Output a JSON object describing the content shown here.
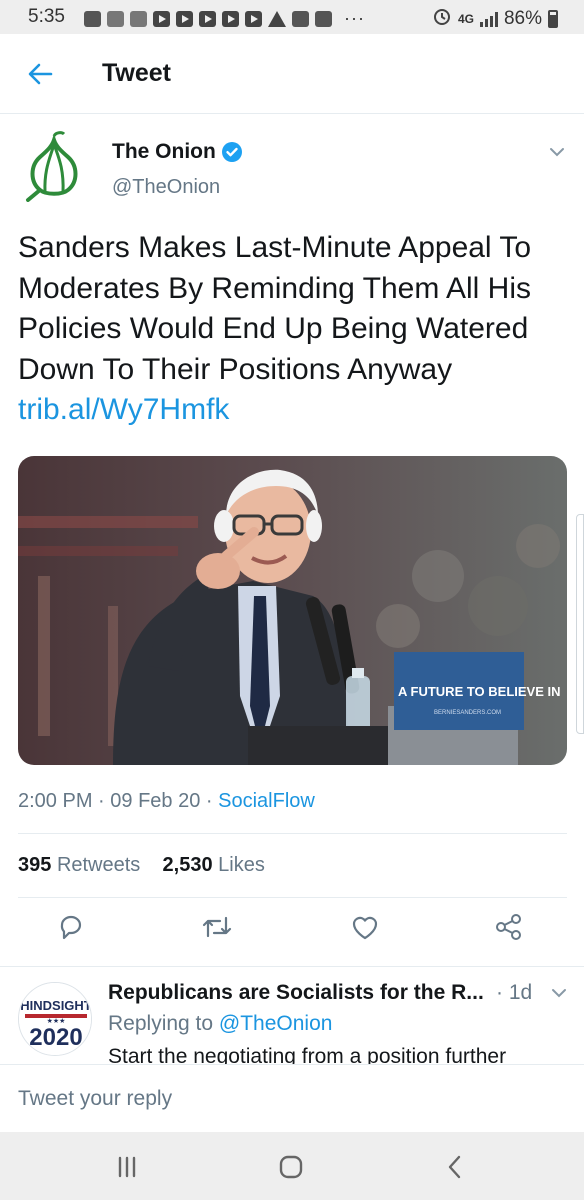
{
  "status_bar": {
    "time": "5:35",
    "network": "4G",
    "battery": "86%"
  },
  "header": {
    "title": "Tweet"
  },
  "tweet": {
    "author_name": "The Onion",
    "author_handle": "@TheOnion",
    "text": "Sanders Makes Last-Minute Appeal To Moderates By Reminding Them All His Policies Would End Up Being Watered Down To Their Positions Anyway",
    "link": "trib.al/Wy7Hmfk",
    "media": {
      "sign_text": "A FUTURE TO BELIEVE IN",
      "sign_subtext": "BERNIESANDERS.COM"
    },
    "time": "2:00 PM",
    "date": "09 Feb 20",
    "source": "SocialFlow",
    "retweets_count": "395",
    "retweets_label": "Retweets",
    "likes_count": "2,530",
    "likes_label": "Likes",
    "separator": " · "
  },
  "reply": {
    "author_name": "Republicans are Socialists for the R...",
    "time": "1d",
    "replying_to_label": "Replying to",
    "replying_to_handle": "@TheOnion",
    "body": "Start the negotiating from a position further",
    "avatar_text_top": "HINDSIGHT",
    "avatar_text_bottom": "2020",
    "avatar_stars": "★★★"
  },
  "compose": {
    "placeholder": "Tweet your reply"
  },
  "colors": {
    "accent": "#1b95e0",
    "onion_green": "#2e8b3a",
    "muted": "#657786"
  }
}
